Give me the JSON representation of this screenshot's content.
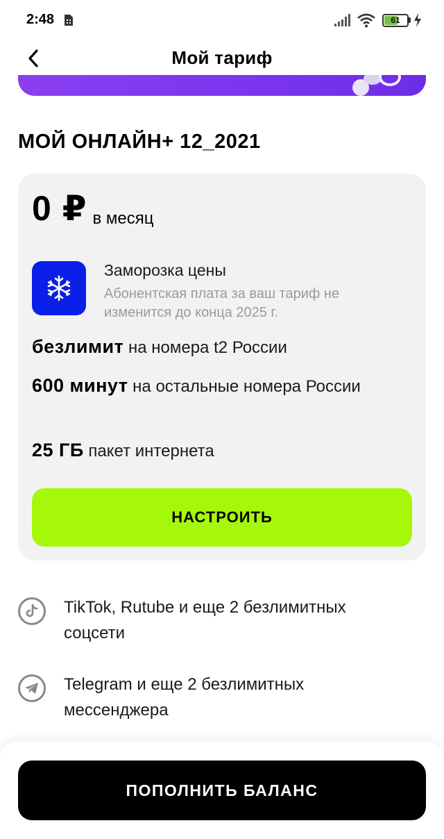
{
  "status_bar": {
    "time": "2:48",
    "battery_level": "61",
    "battery_fraction": 0.61,
    "icons": [
      "sim-icon",
      "signal-icon",
      "wifi-icon",
      "battery-icon",
      "charging-bolt-icon"
    ]
  },
  "header": {
    "title": "Мой тариф",
    "back_icon": "chevron-left-icon"
  },
  "banner": {
    "colors": [
      "#8a3ff0",
      "#6d2de6"
    ]
  },
  "plan": {
    "name": "МОЙ ОНЛАЙН+ 12_2021",
    "price_value": "0 ₽",
    "price_period": "в месяц",
    "freeze": {
      "icon": "snowflake-icon",
      "title": "Заморозка цены",
      "description": "Абонентская плата за ваш тариф не изменится до конца 2025 г."
    },
    "features": [
      {
        "bold": "безлимит",
        "text": " на номера t2 России"
      },
      {
        "bold": "600 минут",
        "text": " на остальные номера России"
      },
      {
        "bold": "25 ГБ",
        "text": " пакет интернета"
      }
    ],
    "configure_label": "НАСТРОИТЬ"
  },
  "extras": [
    {
      "icon": "tiktok-icon",
      "text": "TikTok, Rutube и еще 2 безлимитных соцсети"
    },
    {
      "icon": "telegram-icon",
      "text": "Telegram и еще 2 безлимитных мессенджера"
    }
  ],
  "bottom": {
    "topup_label": "ПОПОЛНИТЬ БАЛАНС"
  },
  "colors": {
    "accent_green": "#a6f80a",
    "freeze_blue": "#0a1fe8",
    "card_bg": "#f2f2f2",
    "primary_button": "#000000"
  }
}
